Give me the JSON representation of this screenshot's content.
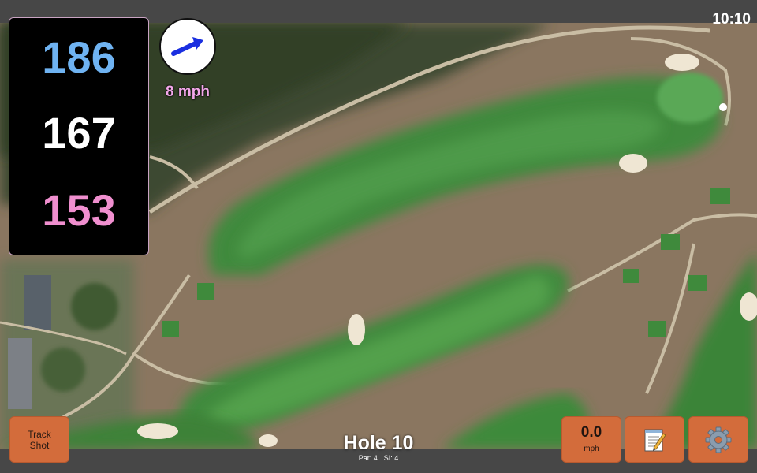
{
  "status_bar": {
    "time": "10:10"
  },
  "distances": {
    "back": "186",
    "middle": "167",
    "front": "153",
    "colors": {
      "back": "#6fb3f2",
      "middle": "#ffffff",
      "front": "#f08fcf"
    }
  },
  "wind": {
    "speed_label": "8 mph",
    "direction_icon": "arrow-northeast-icon",
    "arrow_color": "#1a2fe0",
    "label_color": "#f3a7ea"
  },
  "hole": {
    "title": "Hole 10",
    "par": "Par: 4",
    "si": "SI: 4"
  },
  "buttons": {
    "track_shot": "Track\nShot",
    "speed_value": "0.0",
    "speed_unit": "mph",
    "notes_icon": "notepad-icon",
    "settings_icon": "gear-icon"
  },
  "colors": {
    "button_bg": "#d36c3b",
    "bar_bg": "#474747"
  }
}
